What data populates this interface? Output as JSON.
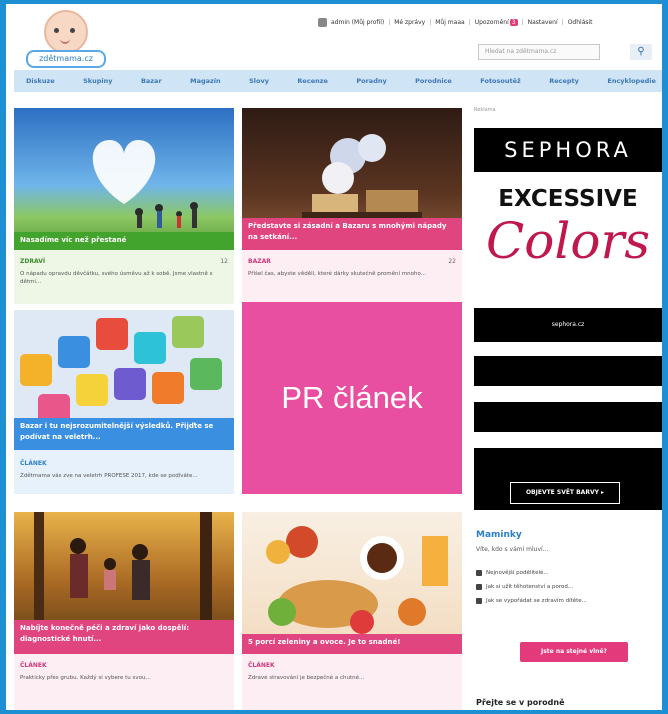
{
  "header": {
    "logo_text": "zdětmama.cz",
    "topbar": [
      "admin (Můj profil)",
      "Mé zprávy",
      "Můj maaa",
      "Upozornění",
      "Nastavení",
      "Odhlásit"
    ],
    "notification_count": "3",
    "search_placeholder": "Hledat na zdětmama.cz",
    "search_icon": "search-icon"
  },
  "nav": [
    "Diskuze",
    "Skupiny",
    "Bazar",
    "Magazín",
    "Slovy",
    "Recenze",
    "Poradny",
    "Porodnice",
    "Fotosoutěž",
    "Recepty",
    "Encyklopedie"
  ],
  "cards": [
    {
      "title": "Nasadíme víc než přestané",
      "tag": "ZDRAVÍ",
      "count": "12",
      "desc": "O nápadu opravdu děvčátku, svého úsměvu až k sobě. Jsme vlastně s dětmi..."
    },
    {
      "title": "Představte si zásadní a Bazaru s mnohými nápady na setkání...",
      "tag": "BAZAR",
      "count": "22",
      "desc": "Přišel čas, abyste věděli, které dárky skutečně promění mnoho..."
    },
    {
      "title": "Bazar i tu nejsrozumitelnější výsledků. Přijďte se podívat na veletrh...",
      "tag": "ČLÁNEK",
      "count": "",
      "desc": "Zdětmama vás zve na veletrh PROFESE 2017, kde se podíváte..."
    },
    {
      "title": "Nabíjte konečně péči a zdraví jako dospělí: diagnostické hnutí...",
      "tag": "ČLÁNEK",
      "count": "",
      "desc": "Prakticky přes grubu. Každý si vybere tu svou..."
    },
    {
      "title": "5 porcí zeleniny a ovoce. Je to snadné!",
      "tag": "ČLÁNEK",
      "count": "",
      "desc": "Zdravé stravování je bezpečné a chutné..."
    }
  ],
  "pr_text": "PR článek",
  "ad": {
    "label": "Reklama",
    "brand": "SEPHORA",
    "headline": "EXCESSIVE",
    "script": "Colors",
    "url": "sephora.cz",
    "cta": "OBJEVTE SVĚT BARVY ▸"
  },
  "maminky": {
    "title": "Maminky",
    "subtitle": "Víte, kdo s vámi mluví...",
    "items": [
      "Nejnovější podělitelé...",
      "Jak si užít těhotenství a porod...",
      "Jak se vypořádat se zdravím dítěte..."
    ],
    "button": "Jste na stejné vlně?"
  },
  "bottom_title": "Přejte se v porodně"
}
